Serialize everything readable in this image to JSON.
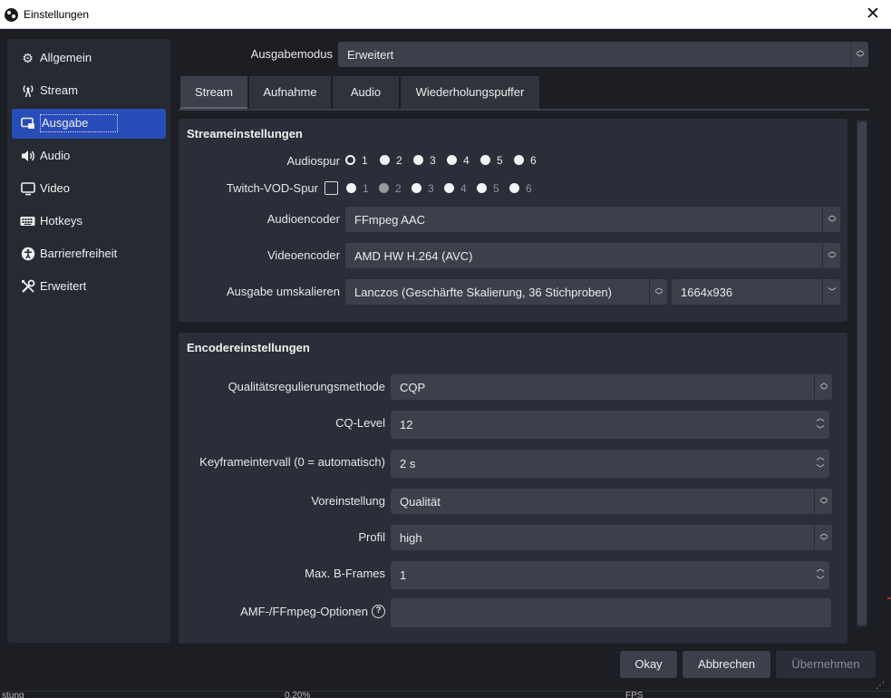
{
  "window": {
    "title": "Einstellungen",
    "close_glyph": "✕"
  },
  "sidebar": {
    "items": [
      {
        "label": "Allgemein",
        "icon": "gear-icon",
        "glyph": "⚙"
      },
      {
        "label": "Stream",
        "icon": "antenna-icon",
        "glyph": "📡"
      },
      {
        "label": "Ausgabe",
        "icon": "output-icon",
        "glyph": "▭"
      },
      {
        "label": "Audio",
        "icon": "speaker-icon",
        "glyph": "🔊"
      },
      {
        "label": "Video",
        "icon": "monitor-icon",
        "glyph": "▢"
      },
      {
        "label": "Hotkeys",
        "icon": "keyboard-icon",
        "glyph": "⌨"
      },
      {
        "label": "Barrierefreiheit",
        "icon": "accessibility-icon",
        "glyph": "♿"
      },
      {
        "label": "Erweitert",
        "icon": "tools-icon",
        "glyph": "✂"
      }
    ],
    "active_index": 2,
    "accent_color": "#284cb8"
  },
  "output_mode": {
    "label": "Ausgabemodus",
    "value": "Erweitert"
  },
  "tabs": [
    "Stream",
    "Aufnahme",
    "Audio",
    "Wiederholungspuffer"
  ],
  "stream_settings": {
    "title": "Streameinstellungen",
    "audio_track_label": "Audiospur",
    "audio_tracks": [
      "1",
      "2",
      "3",
      "4",
      "5",
      "6"
    ],
    "audio_track_selected": "1",
    "twitch_vod_label": "Twitch-VOD-Spur",
    "twitch_vod_checked": false,
    "twitch_tracks": [
      "1",
      "2",
      "3",
      "4",
      "5",
      "6"
    ],
    "twitch_track_selected": "2",
    "audio_encoder_label": "Audioencoder",
    "audio_encoder_value": "FFmpeg AAC",
    "video_encoder_label": "Videoencoder",
    "video_encoder_value": "AMD HW H.264 (AVC)",
    "rescale_label": "Ausgabe umskalieren",
    "rescale_filter_value": "Lanczos (Geschärfte Skalierung, 36 Stichproben)",
    "rescale_resolution_value": "1664x936"
  },
  "encoder_settings": {
    "title": "Encodereinstellungen",
    "rate_control_label": "Qualitätsregulierungsmethode",
    "rate_control_value": "CQP",
    "cq_level_label": "CQ-Level",
    "cq_level_value": "12",
    "keyframe_label": "Keyframeintervall (0 = automatisch)",
    "keyframe_value": "2 s",
    "preset_label": "Voreinstellung",
    "preset_value": "Qualität",
    "profile_label": "Profil",
    "profile_value": "high",
    "bframes_label": "Max. B-Frames",
    "bframes_value": "1",
    "amf_options_label": "AMF-/FFmpeg-Optionen",
    "amf_options_value": "",
    "help_glyph": "?"
  },
  "buttons": {
    "ok": "Okay",
    "cancel": "Abbrechen",
    "apply": "Übernehmen"
  },
  "status_bar": {
    "left_text": "stung",
    "mid_text": "0.20%",
    "right_text": "FPS"
  }
}
